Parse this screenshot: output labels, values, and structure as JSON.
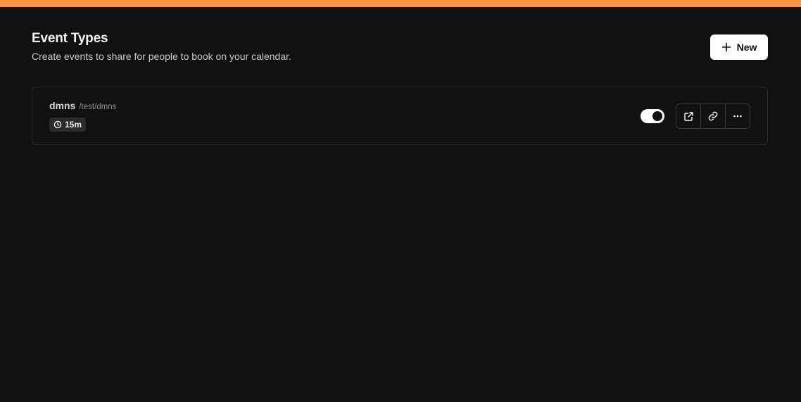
{
  "header": {
    "title": "Event Types",
    "subtitle": "Create events to share for people to book on your calendar.",
    "new_button_label": "New",
    "new_button_icon": "plus-icon"
  },
  "event_types": [
    {
      "title": "dmns",
      "slug": "/test/dmns",
      "duration": "15m",
      "duration_icon": "clock-icon",
      "enabled": true,
      "actions": [
        "external-link-icon",
        "link-icon",
        "more-horizontal-icon"
      ]
    }
  ],
  "colors": {
    "accent_bar": "#fd953e",
    "background": "#111111",
    "card_border": "#2a2a2a"
  }
}
